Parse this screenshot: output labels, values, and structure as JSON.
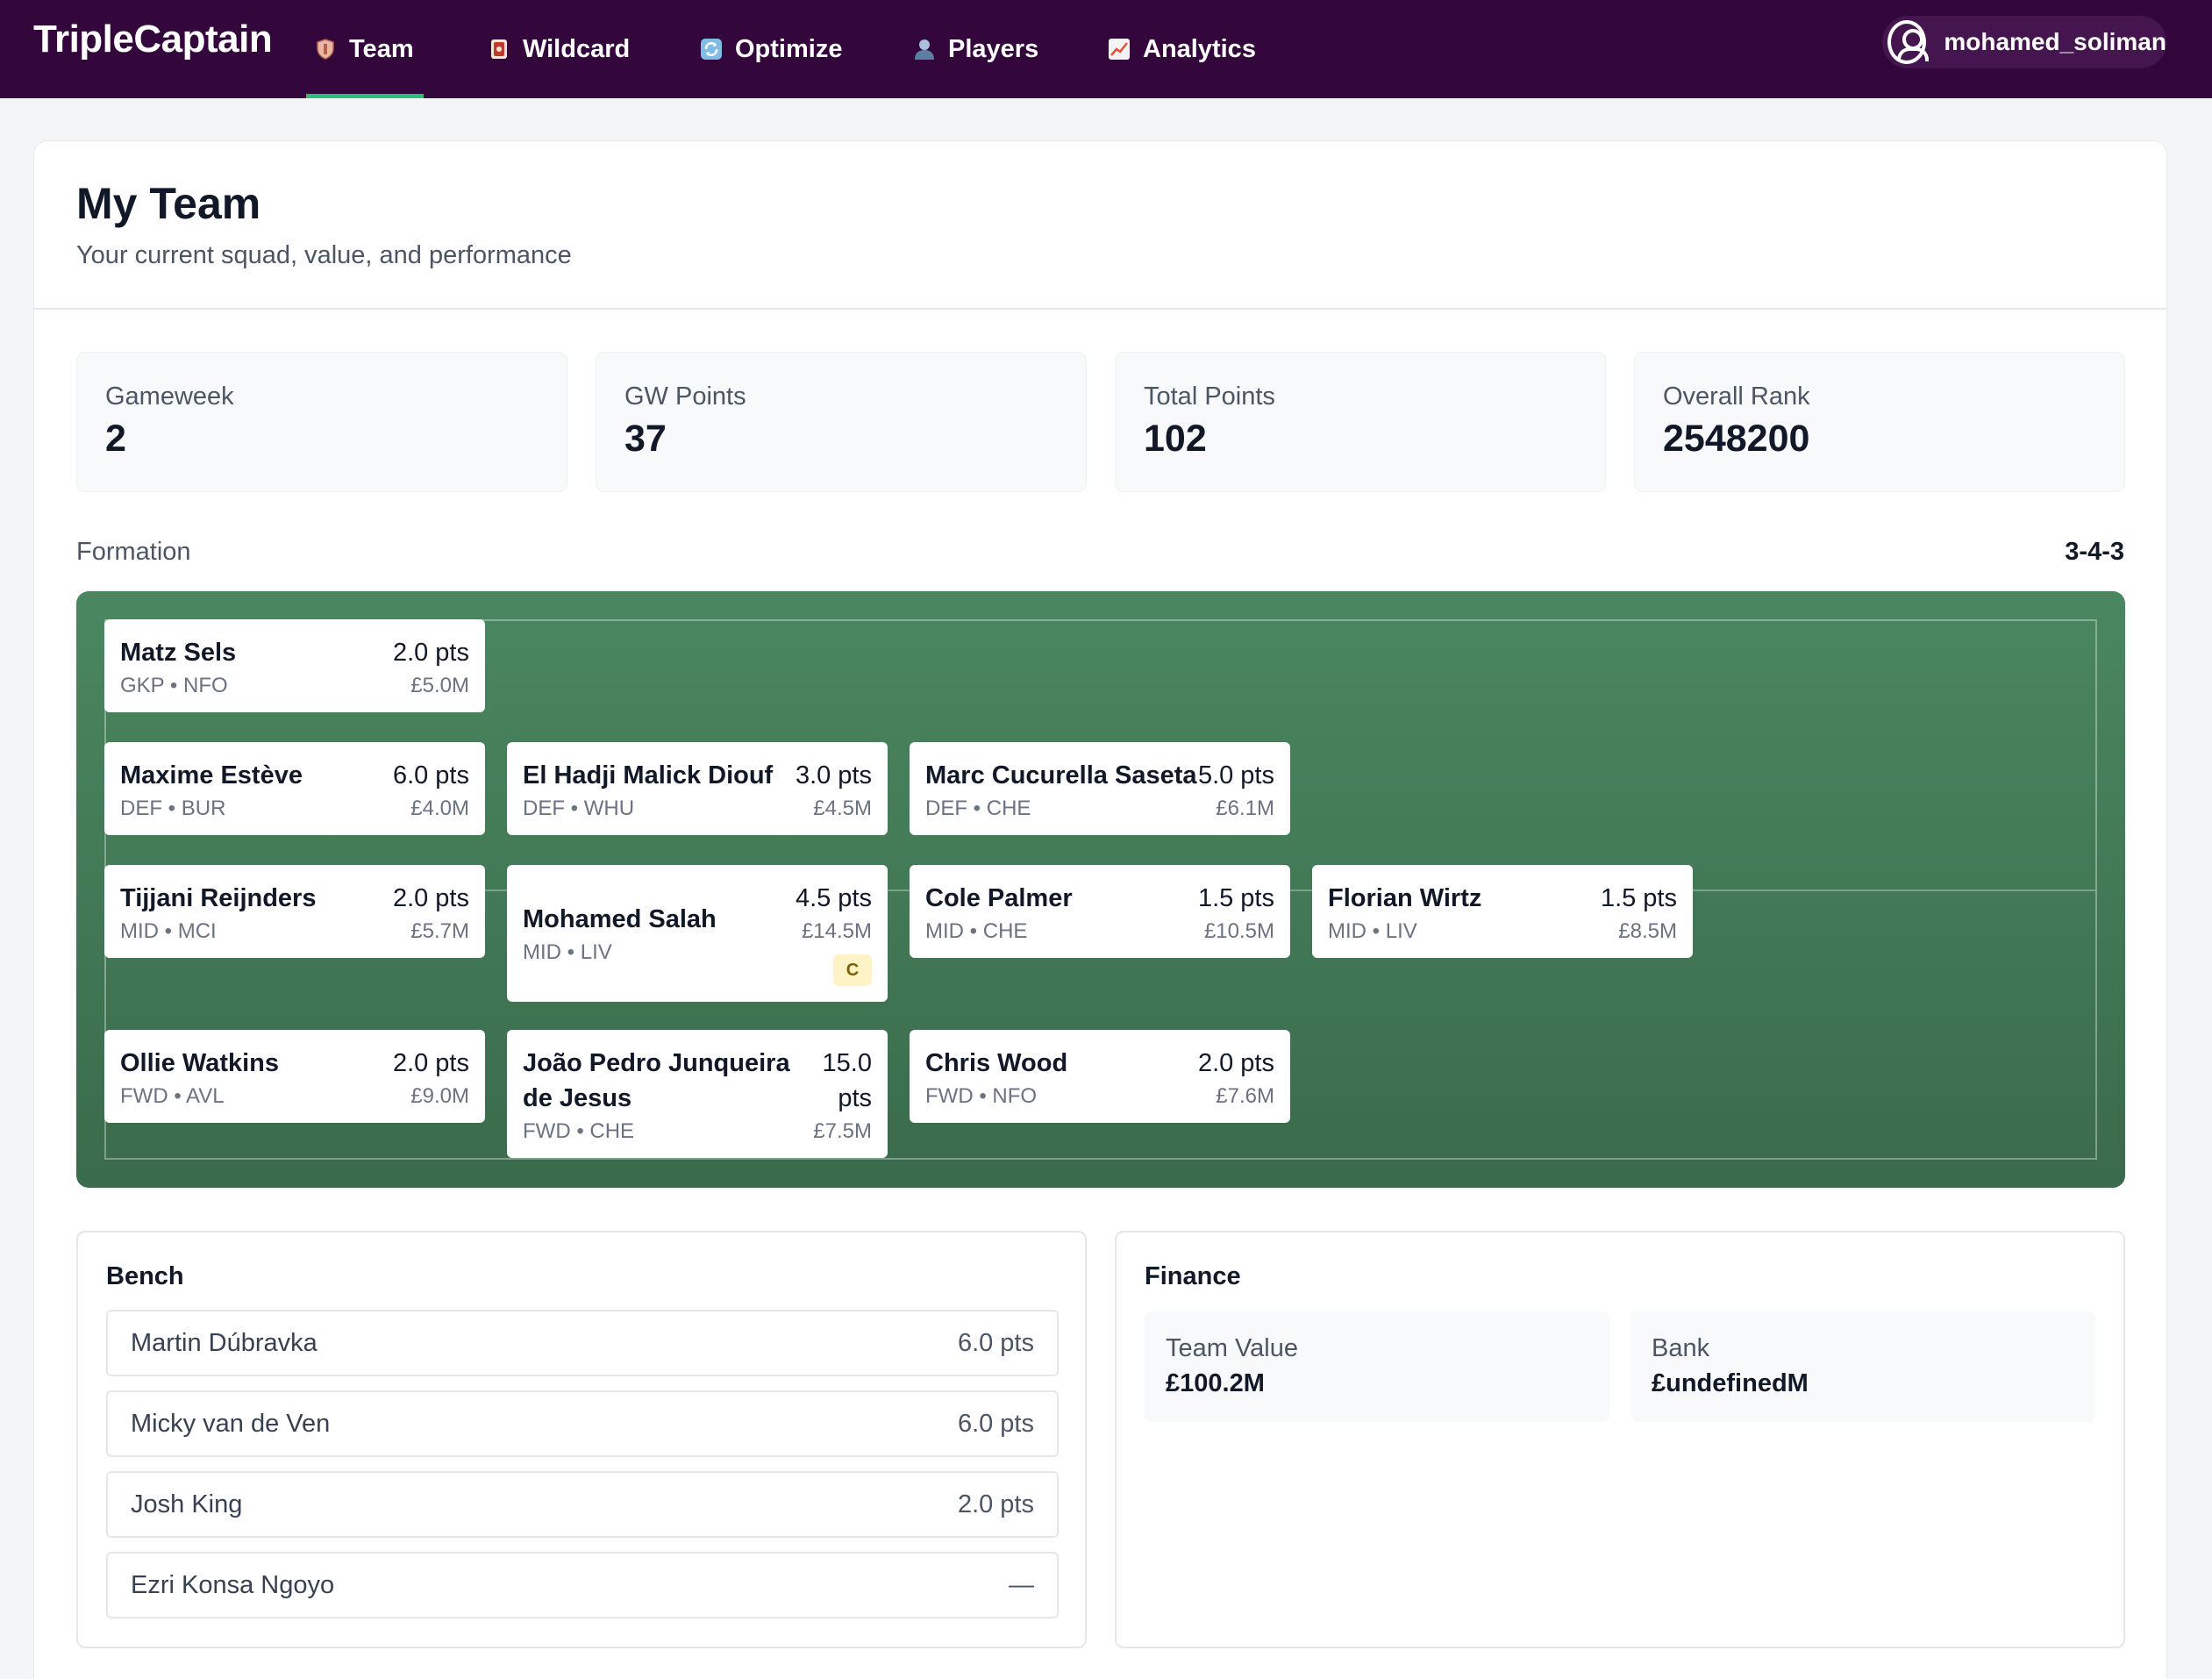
{
  "app": {
    "brand": "TripleCaptain",
    "username": "mohamed_soliman"
  },
  "nav": {
    "items": [
      {
        "label": "Team",
        "icon": "shield-icon",
        "icon_color": "#e8b4a0",
        "active": true
      },
      {
        "label": "Wildcard",
        "icon": "card-icon",
        "icon_color": "#c0392b",
        "active": false
      },
      {
        "label": "Optimize",
        "icon": "refresh-icon",
        "icon_color": "#6ab0e0",
        "active": false
      },
      {
        "label": "Players",
        "icon": "person-icon",
        "icon_color": "#8aa8c8",
        "active": false
      },
      {
        "label": "Analytics",
        "icon": "chart-icon",
        "icon_color": "#e74c3c",
        "active": false
      }
    ]
  },
  "header": {
    "title": "My Team",
    "subtitle": "Your current squad, value, and performance"
  },
  "stats": [
    {
      "label": "Gameweek",
      "value": "2"
    },
    {
      "label": "GW Points",
      "value": "37"
    },
    {
      "label": "Total Points",
      "value": "102"
    },
    {
      "label": "Overall Rank",
      "value": "2548200"
    }
  ],
  "formation": {
    "label": "Formation",
    "value": "3-4-3"
  },
  "pitch": {
    "gkp": [
      {
        "name": "Matz Sels",
        "points": "2.0 pts",
        "meta": "GKP • NFO",
        "price": "£5.0M"
      }
    ],
    "def": [
      {
        "name": "Maxime Estève",
        "points": "6.0 pts",
        "meta": "DEF • BUR",
        "price": "£4.0M"
      },
      {
        "name": "El Hadji Malick Diouf",
        "points": "3.0 pts",
        "meta": "DEF • WHU",
        "price": "£4.5M"
      },
      {
        "name": "Marc Cucurella Saseta",
        "points": "5.0 pts",
        "meta": "DEF • CHE",
        "price": "£6.1M"
      }
    ],
    "mid": [
      {
        "name": "Tijjani Reijnders",
        "points": "2.0 pts",
        "meta": "MID • MCI",
        "price": "£5.7M"
      },
      {
        "name": "Mohamed Salah",
        "points": "4.5 pts",
        "meta": "MID • LIV",
        "price": "£14.5M",
        "captain": "C"
      },
      {
        "name": "Cole Palmer",
        "points": "1.5 pts",
        "meta": "MID • CHE",
        "price": "£10.5M"
      },
      {
        "name": "Florian Wirtz",
        "points": "1.5 pts",
        "meta": "MID • LIV",
        "price": "£8.5M"
      }
    ],
    "fwd": [
      {
        "name": "Ollie Watkins",
        "points": "2.0 pts",
        "meta": "FWD • AVL",
        "price": "£9.0M"
      },
      {
        "name_line1": "João Pedro Junqueira",
        "name_line2": "de Jesus",
        "points_line1": "15.0",
        "points_line2": "pts",
        "meta": "FWD • CHE",
        "price": "£7.5M"
      },
      {
        "name": "Chris Wood",
        "points": "2.0 pts",
        "meta": "FWD • NFO",
        "price": "£7.6M"
      }
    ]
  },
  "bench": {
    "title": "Bench",
    "players": [
      {
        "name": "Martin Dúbravka",
        "points": "6.0 pts"
      },
      {
        "name": "Micky van de Ven",
        "points": "6.0 pts"
      },
      {
        "name": "Josh King",
        "points": "2.0 pts"
      },
      {
        "name": "Ezri Konsa Ngoyo",
        "points": "—"
      }
    ]
  },
  "finance": {
    "title": "Finance",
    "team_value_label": "Team Value",
    "team_value": "£100.2M",
    "bank_label": "Bank",
    "bank": "£undefinedM"
  }
}
